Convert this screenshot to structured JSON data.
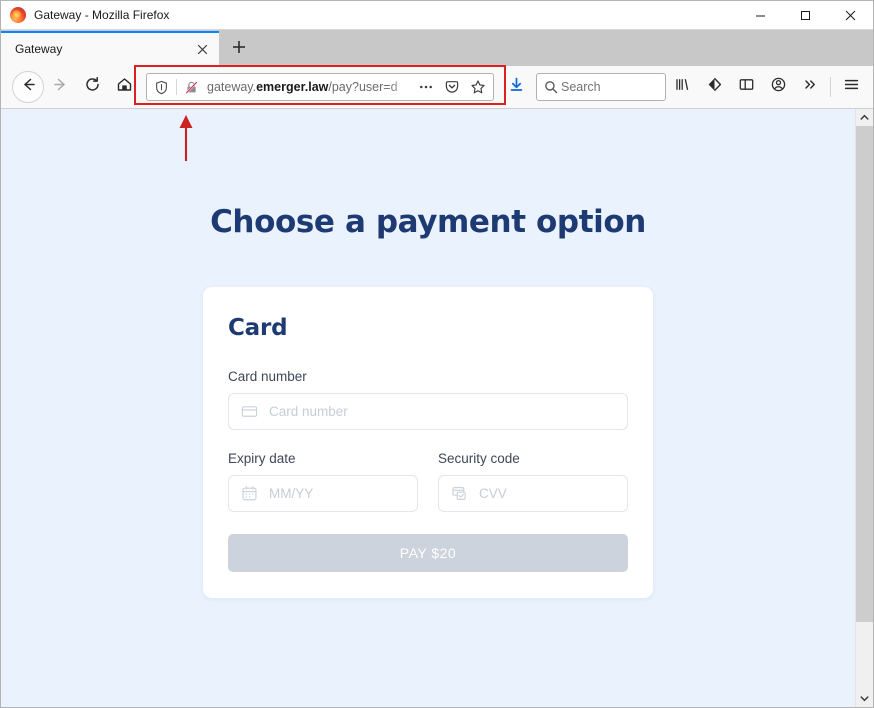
{
  "window": {
    "title": "Gateway - Mozilla Firefox",
    "logo_icon": "firefox-logo-icon",
    "minimize_icon": "minimize-icon",
    "maximize_icon": "maximize-icon",
    "close_icon": "close-icon"
  },
  "tabs": {
    "items": [
      {
        "title": "Gateway",
        "active": true,
        "close_icon": "close-tab-icon"
      }
    ],
    "new_tab_icon": "plus-icon"
  },
  "toolbar": {
    "back_icon": "back-arrow-icon",
    "forward_icon": "forward-arrow-icon",
    "reload_icon": "reload-icon",
    "home_icon": "home-icon",
    "shield_icon": "shield-icon",
    "insecure_lock_icon": "lock-crossed-out-icon",
    "url_prefix": "gateway.",
    "url_domain": "emerger.law",
    "url_path": "/pay?user=d",
    "url_full": "gateway.emerger.law/pay?user=d",
    "page_actions_icon": "ellipsis-icon",
    "pocket_icon": "pocket-icon",
    "bookmark_icon": "star-icon",
    "downloads_icon": "download-arrow-icon",
    "library_icon": "library-icon",
    "sync_icon": "sync-icon",
    "sidebar_icon": "sidebar-icon",
    "account_icon": "account-icon",
    "overflow_icon": "double-chevron-icon",
    "menu_icon": "hamburger-menu-icon"
  },
  "search": {
    "placeholder": "Search",
    "icon": "search-icon"
  },
  "annotation": {
    "highlight_color": "#e02020",
    "arrow_icon": "up-arrow-annotation",
    "target": "url-bar"
  },
  "page": {
    "title": "Choose a payment option",
    "background_color": "#eaf2fe",
    "heading_color": "#1e3a73",
    "card": {
      "heading": "Card",
      "fields": [
        {
          "label": "Card number",
          "placeholder": "Card number",
          "value": "",
          "icon": "credit-card-icon"
        },
        {
          "label": "Expiry date",
          "placeholder": "MM/YY",
          "value": "",
          "icon": "calendar-icon"
        },
        {
          "label": "Security code",
          "placeholder": "CVV",
          "value": "",
          "icon": "cvv-card-icon"
        }
      ],
      "pay_button": {
        "label": "PAY $20",
        "amount": "$20",
        "disabled": true,
        "background_color": "#ccd3dd",
        "text_color": "#ffffff"
      }
    }
  },
  "scrollbar": {
    "up_icon": "scroll-up-icon",
    "down_icon": "scroll-down-icon"
  }
}
